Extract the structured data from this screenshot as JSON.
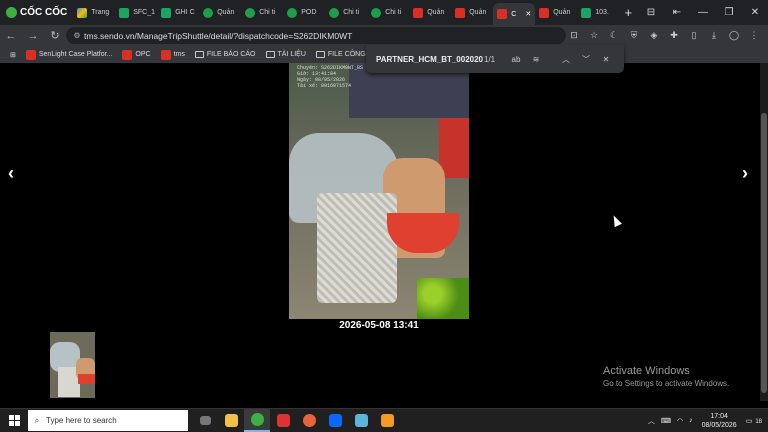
{
  "browser": {
    "brand": "CỐC CỐC",
    "tabs": [
      {
        "label": "Trang",
        "icon": "gdrive"
      },
      {
        "label": "SFC_1",
        "icon": "sheet"
      },
      {
        "label": "GHI C",
        "icon": "sheet"
      },
      {
        "label": "Quản",
        "icon": "green"
      },
      {
        "label": "Chi ti",
        "icon": "green"
      },
      {
        "label": "POD",
        "icon": "green"
      },
      {
        "label": "Chi ti",
        "icon": "green"
      },
      {
        "label": "Chi ti",
        "icon": "green"
      },
      {
        "label": "Quản",
        "icon": "red"
      },
      {
        "label": "Quản",
        "icon": "red"
      },
      {
        "label": "C",
        "icon": "red",
        "active": true
      },
      {
        "label": "Quản",
        "icon": "red"
      },
      {
        "label": "103.",
        "icon": "sheet"
      }
    ],
    "url": "tms.sendo.vn/ManageTripShuttle/detail/?dispatchcode=S262DIKM0WT",
    "bookmarks": [
      "SenLight Case Platfor...",
      "OPC",
      "tms",
      "FILE BÁO CÁO",
      "TÀI LIỆU",
      "FILE CÔNG VIỆC"
    ]
  },
  "findbar": {
    "query": "PARTNER_HCM_BT_002020",
    "count": "1/1"
  },
  "viewer": {
    "caption": "2026-05-08 13:41",
    "stamp_lines": [
      "Chuyến: S262DIKM0WT_BS",
      "Giờ: 13:41:04",
      "Ngày: 08/05/2026",
      "Tài xế: 0916071574"
    ],
    "prev": "‹",
    "next": "›"
  },
  "watermark": {
    "title": "Activate Windows",
    "subtitle": "Go to Settings to activate Windows."
  },
  "taskbar": {
    "search_placeholder": "Type here to search",
    "time": "17:04",
    "date": "08/05/2026",
    "notifications": "18"
  }
}
